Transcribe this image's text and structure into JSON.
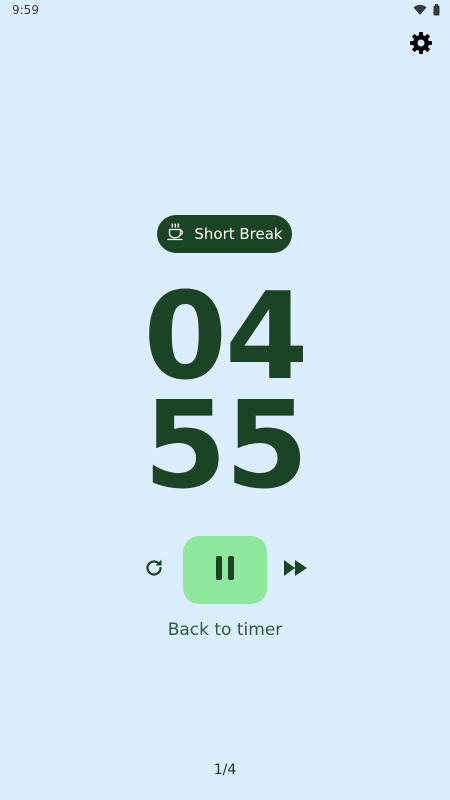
{
  "status_bar": {
    "time": "9:59",
    "icons": [
      "wifi-icon",
      "battery-icon"
    ]
  },
  "header": {
    "settings_icon": "gear-icon"
  },
  "mode_chip": {
    "icon": "coffee-cup-icon",
    "label": "Short Break"
  },
  "timer": {
    "minutes": "04",
    "seconds": "55"
  },
  "controls": {
    "reset_icon": "refresh-icon",
    "pause_icon": "pause-icon",
    "skip_icon": "fast-forward-icon"
  },
  "back_link": "Back to timer",
  "session_counter": "1/4",
  "colors": {
    "background": "#dbeeff",
    "primary_dark": "#1b4424",
    "pause_button": "#8ee89c"
  }
}
